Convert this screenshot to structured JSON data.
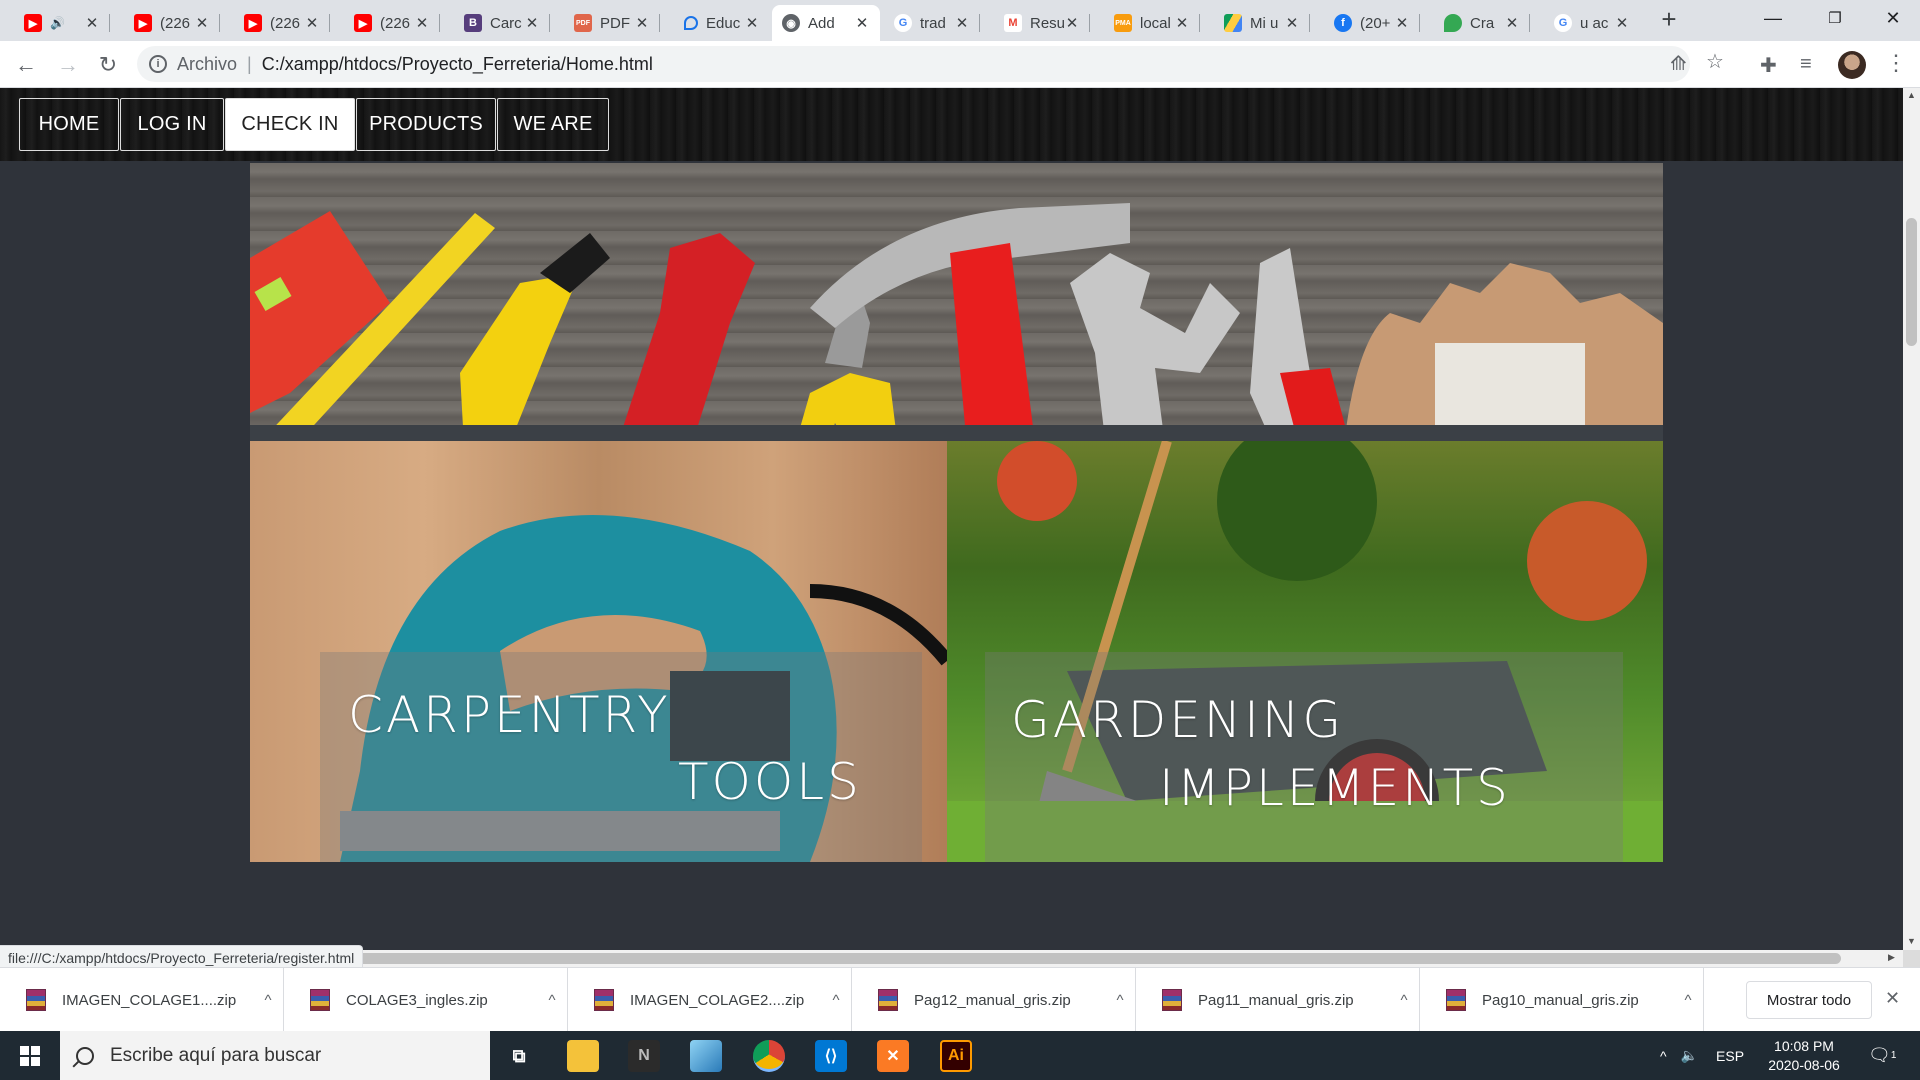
{
  "browser": {
    "tabs": [
      {
        "label": "",
        "favicon": "youtube-icon",
        "audio": true
      },
      {
        "label": "(226",
        "favicon": "youtube-icon"
      },
      {
        "label": "(226",
        "favicon": "youtube-icon"
      },
      {
        "label": "(226",
        "favicon": "youtube-icon"
      },
      {
        "label": "Carc",
        "favicon": "bootstrap-icon"
      },
      {
        "label": "PDF",
        "favicon": "pdf-png-icon"
      },
      {
        "label": "Educ",
        "favicon": "location-pin-icon"
      },
      {
        "label": "Add",
        "favicon": "globe-icon",
        "active": true
      },
      {
        "label": "trad",
        "favicon": "google-icon"
      },
      {
        "label": "Resu",
        "favicon": "gmail-icon"
      },
      {
        "label": "local",
        "favicon": "phpmyadmin-icon"
      },
      {
        "label": "Mi u",
        "favicon": "google-drive-icon"
      },
      {
        "label": "(20+",
        "favicon": "facebook-icon"
      },
      {
        "label": "Cra",
        "favicon": "google-maps-icon"
      },
      {
        "label": "u ac",
        "favicon": "google-icon"
      }
    ],
    "url_scheme_label": "Archivo",
    "url": "C:/xampp/htdocs/Proyecto_Ferreteria/Home.html",
    "status_url": "file:///C:/xampp/htdocs/Proyecto_Ferreteria/register.html",
    "colors": {
      "tab_strip": "#dee1e6",
      "toolbar": "#ffffff"
    }
  },
  "site": {
    "nav": [
      "HOME",
      "LOG IN",
      "CHECK IN",
      "PRODUCTS",
      "WE ARE"
    ],
    "nav_selected_index": 2,
    "cards": [
      {
        "line1": "CARPENTRY",
        "line2": "TOOLS"
      },
      {
        "line1": "GARDENING",
        "line2": "IMPLEMENTS"
      }
    ],
    "colors": {
      "page_bg": "#2f333a",
      "nav_bg": "#161616"
    }
  },
  "downloads": {
    "items": [
      "IMAGEN_COLAGE1....zip",
      "COLAGE3_ingles.zip",
      "IMAGEN_COLAGE2....zip",
      "Pag12_manual_gris.zip",
      "Pag11_manual_gris.zip",
      "Pag10_manual_gris.zip"
    ],
    "show_all": "Mostrar todo"
  },
  "taskbar": {
    "search_placeholder": "Escribe aquí para buscar",
    "apps": [
      "task-view-icon",
      "file-explorer-icon",
      "notepad-n-icon",
      "photos-icon",
      "chrome-icon",
      "vscode-icon",
      "xampp-icon",
      "illustrator-icon"
    ],
    "illustrator_label": "Ai",
    "language": "ESP",
    "time": "10:08 PM",
    "date": "2020-08-06",
    "notification_count": "1"
  }
}
